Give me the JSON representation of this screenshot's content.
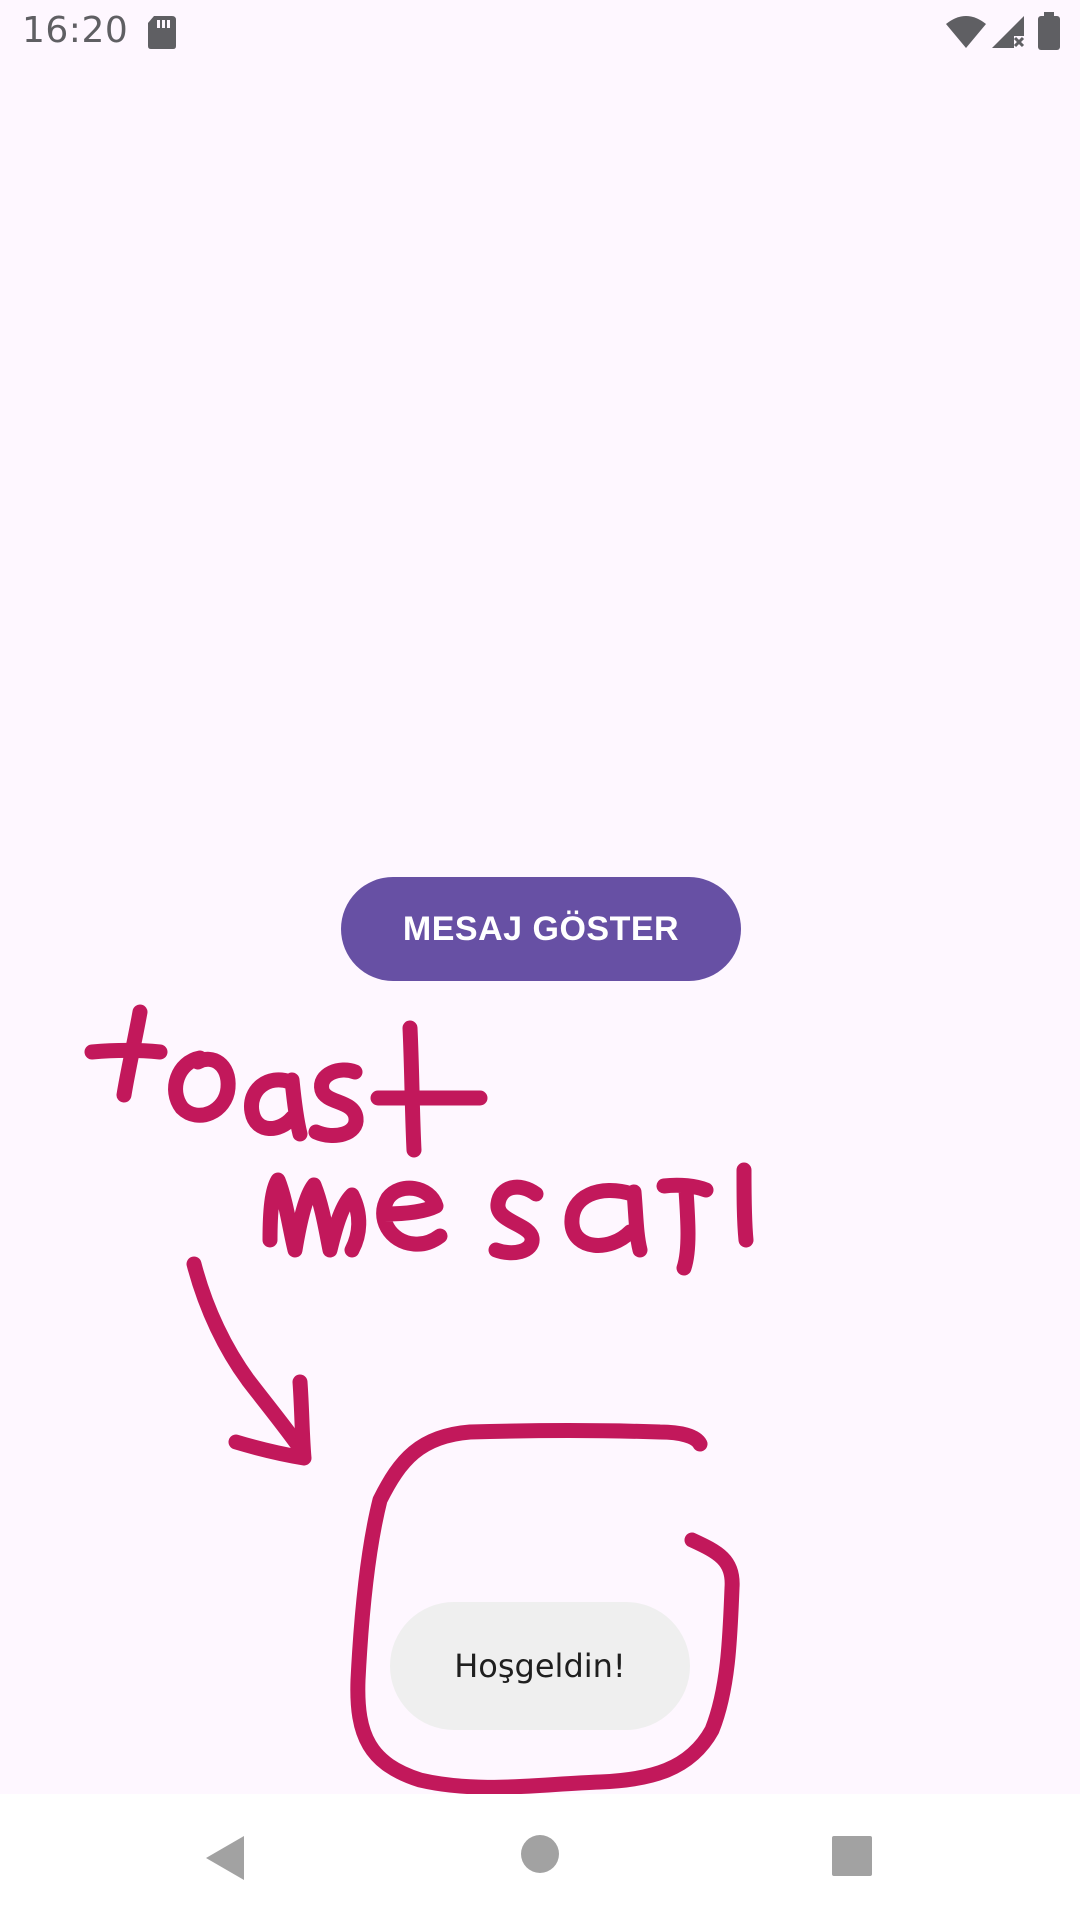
{
  "status_bar": {
    "time": "16:20",
    "icons": [
      "sd-card-icon",
      "wifi-icon",
      "signal-icon",
      "battery-icon"
    ]
  },
  "main": {
    "button_label": "MESAJ GÖSTER"
  },
  "annotation": {
    "handwritten_text": "toast mesajı",
    "color": "#c2185b"
  },
  "toast": {
    "message": "Hoşgeldin!"
  },
  "nav_bar": {
    "icons": [
      "back-icon",
      "home-icon",
      "recents-icon"
    ]
  },
  "colors": {
    "background": "#fef7ff",
    "button": "#6750a4",
    "toast_background": "#efefef"
  }
}
